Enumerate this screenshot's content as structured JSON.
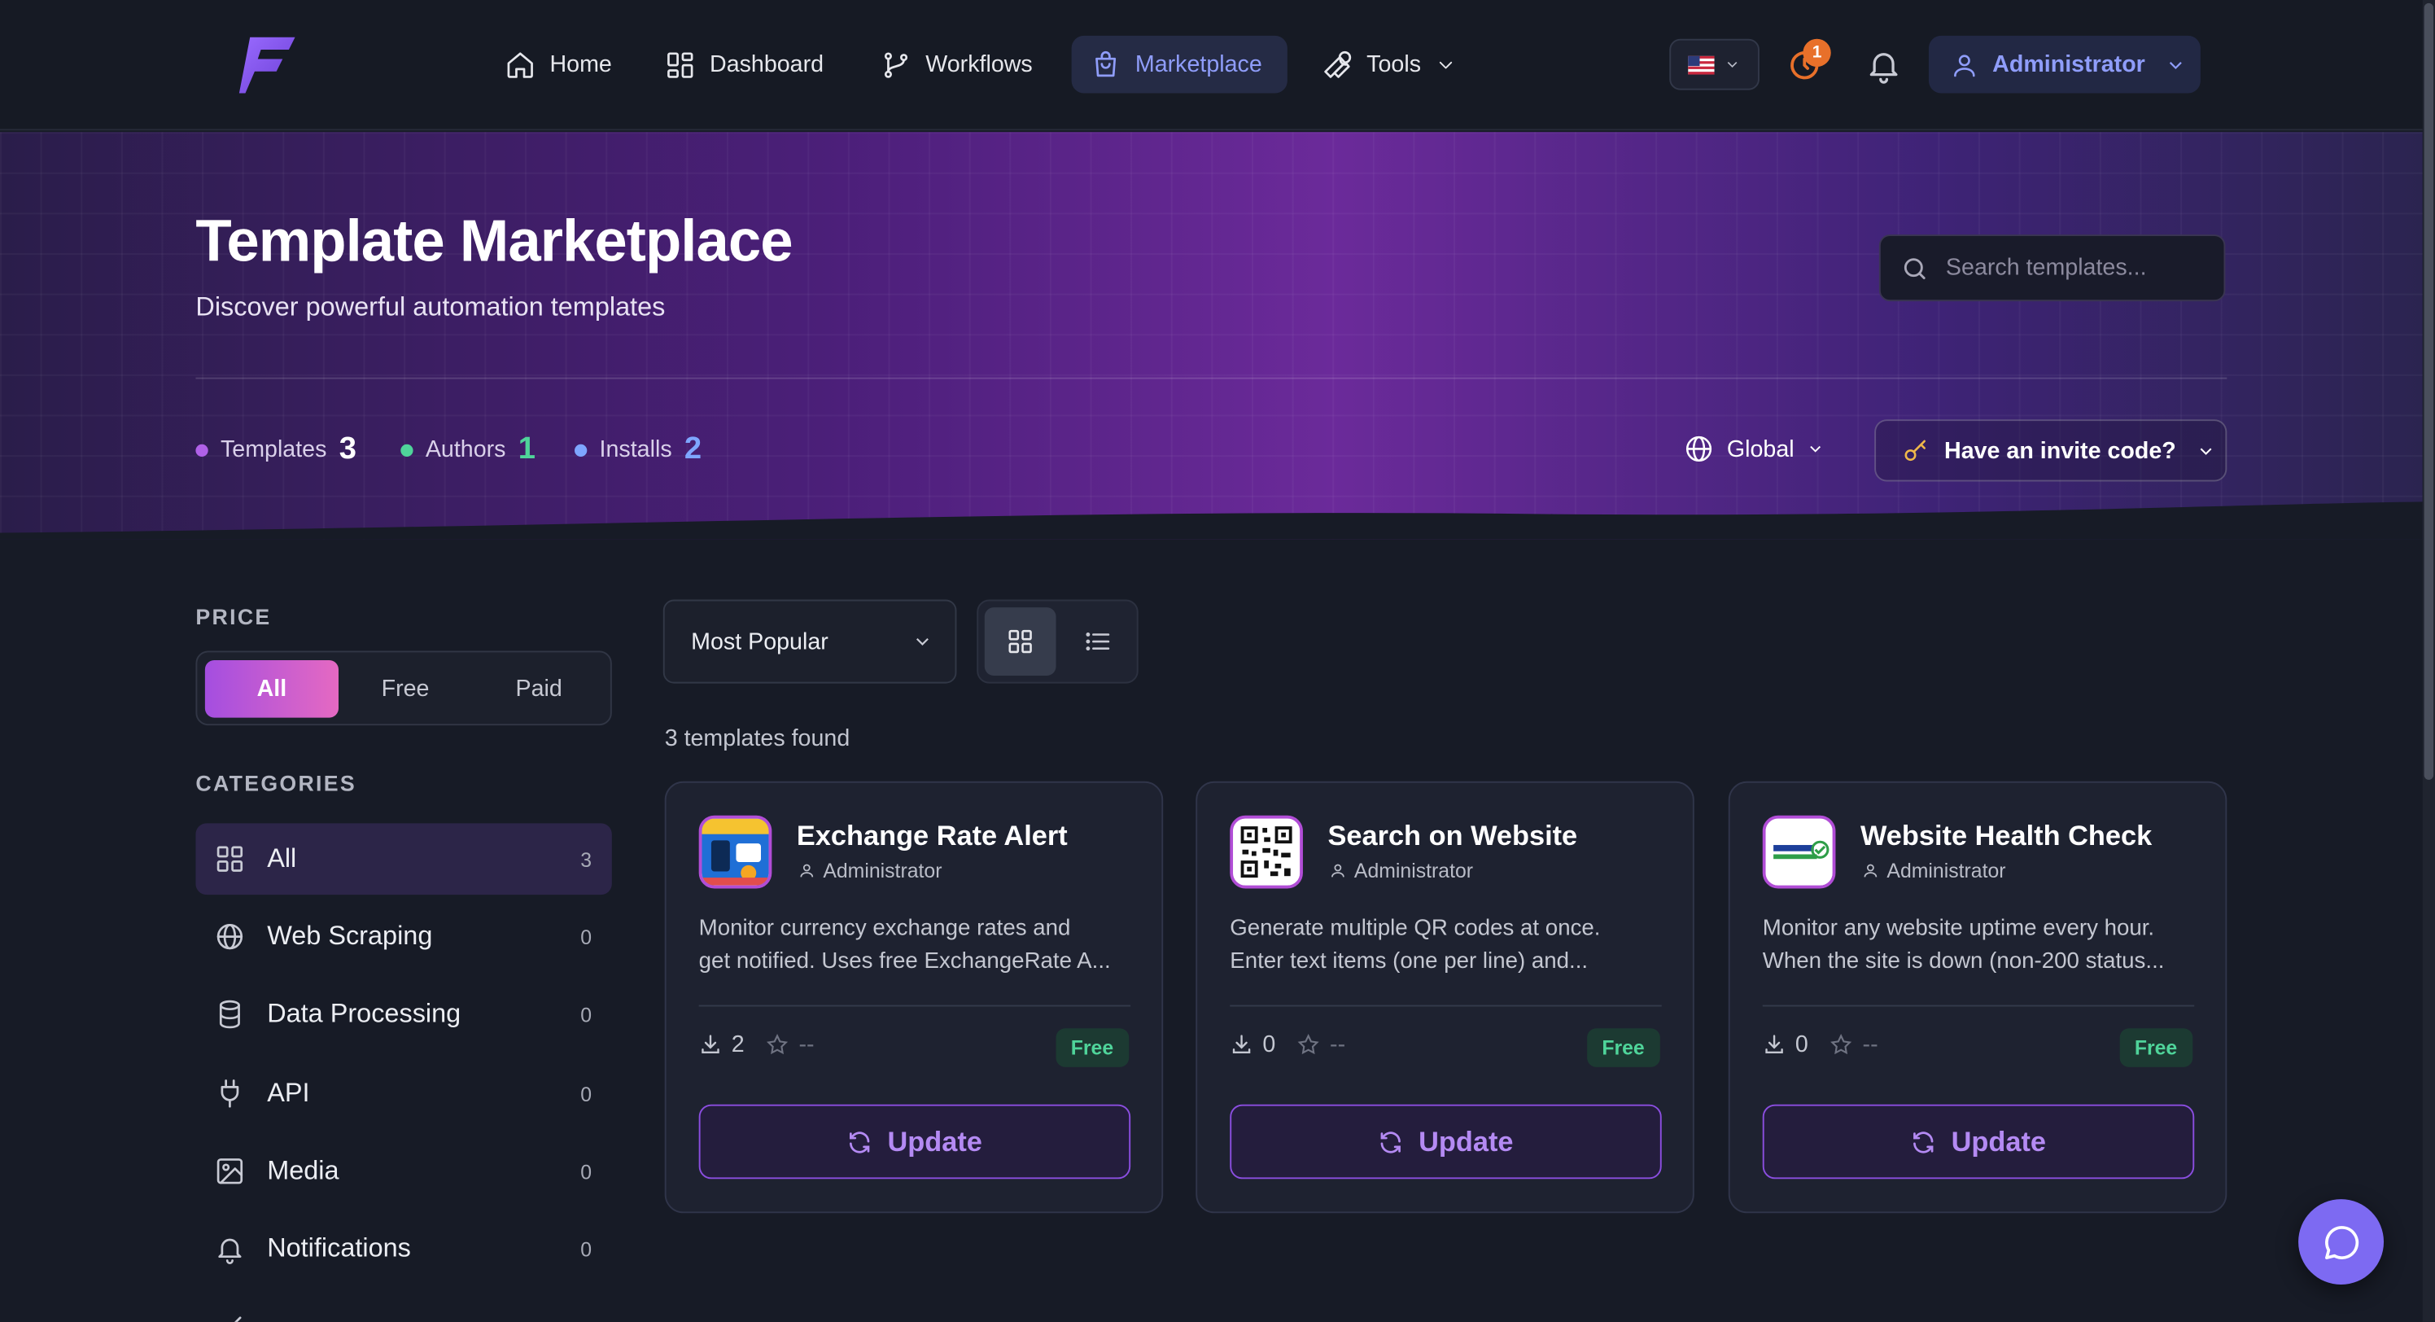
{
  "nav": {
    "items": [
      {
        "label": "Home",
        "icon": "home-icon"
      },
      {
        "label": "Dashboard",
        "icon": "dashboard-icon"
      },
      {
        "label": "Workflows",
        "icon": "workflow-branch-icon"
      },
      {
        "label": "Marketplace",
        "icon": "shopping-bag-icon",
        "active": true
      },
      {
        "label": "Tools",
        "icon": "wrench-icon"
      }
    ],
    "notification_badge": "1",
    "user_label": "Administrator"
  },
  "hero": {
    "title": "Template Marketplace",
    "subtitle": "Discover powerful automation templates",
    "search_placeholder": "Search templates...",
    "stats": [
      {
        "label": "Templates",
        "value": "3",
        "color": "#b061e8"
      },
      {
        "label": "Authors",
        "value": "1",
        "color": "#4fd49a"
      },
      {
        "label": "Installs",
        "value": "2",
        "color": "#7ea6ff"
      }
    ],
    "region_label": "Global",
    "invite_label": "Have an invite code?"
  },
  "sidebar": {
    "price_heading": "PRICE",
    "price_options": [
      "All",
      "Free",
      "Paid"
    ],
    "price_selected": "All",
    "categories_heading": "CATEGORIES",
    "categories": [
      {
        "label": "All",
        "count": "3",
        "icon": "grid-icon",
        "active": true
      },
      {
        "label": "Web Scraping",
        "count": "0",
        "icon": "globe-icon"
      },
      {
        "label": "Data Processing",
        "count": "0",
        "icon": "database-icon"
      },
      {
        "label": "API",
        "count": "0",
        "icon": "plug-icon"
      },
      {
        "label": "Media",
        "count": "0",
        "icon": "image-icon"
      },
      {
        "label": "Notifications",
        "count": "0",
        "icon": "bell-icon"
      }
    ]
  },
  "toolbar": {
    "sort_selected": "Most Popular",
    "results_text": "3 templates found"
  },
  "templates": [
    {
      "title": "Exchange Rate Alert",
      "author": "Administrator",
      "desc_line1": "Monitor currency exchange rates and",
      "desc_line2": "get notified. Uses free ExchangeRate A...",
      "installs": "2",
      "rating": "--",
      "price": "Free",
      "action": "Update"
    },
    {
      "title": "Search on Website",
      "author": "Administrator",
      "desc_line1": "Generate multiple QR codes at once.",
      "desc_line2": "Enter text items (one per line) and...",
      "installs": "0",
      "rating": "--",
      "price": "Free",
      "action": "Update"
    },
    {
      "title": "Website Health Check",
      "author": "Administrator",
      "desc_line1": "Monitor any website uptime every hour.",
      "desc_line2": "When the site is down (non-200 status...",
      "installs": "0",
      "rating": "--",
      "price": "Free",
      "action": "Update"
    }
  ],
  "colors": {
    "accent": "#8f9dfa",
    "brand_purple": "#8b4ee0",
    "free_green": "#4fd49a",
    "notification_orange": "#e8702a"
  }
}
